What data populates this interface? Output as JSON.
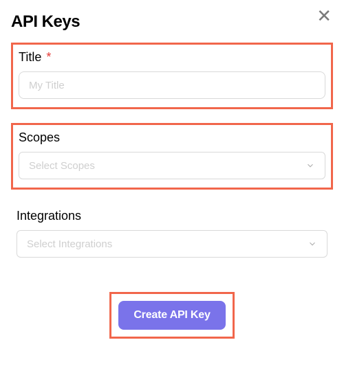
{
  "modal": {
    "title": "API Keys",
    "close_label": "Close"
  },
  "fields": {
    "title": {
      "label": "Title",
      "required_marker": "*",
      "placeholder": "My Title",
      "value": "",
      "highlighted": true
    },
    "scopes": {
      "label": "Scopes",
      "placeholder": "Select Scopes",
      "value": "",
      "highlighted": true
    },
    "integrations": {
      "label": "Integrations",
      "placeholder": "Select Integrations",
      "value": "",
      "highlighted": false
    }
  },
  "actions": {
    "create_label": "Create API Key",
    "highlighted": true
  },
  "colors": {
    "highlight_border": "#f1664b",
    "primary_button": "#7a73ea",
    "required": "#e53935"
  }
}
